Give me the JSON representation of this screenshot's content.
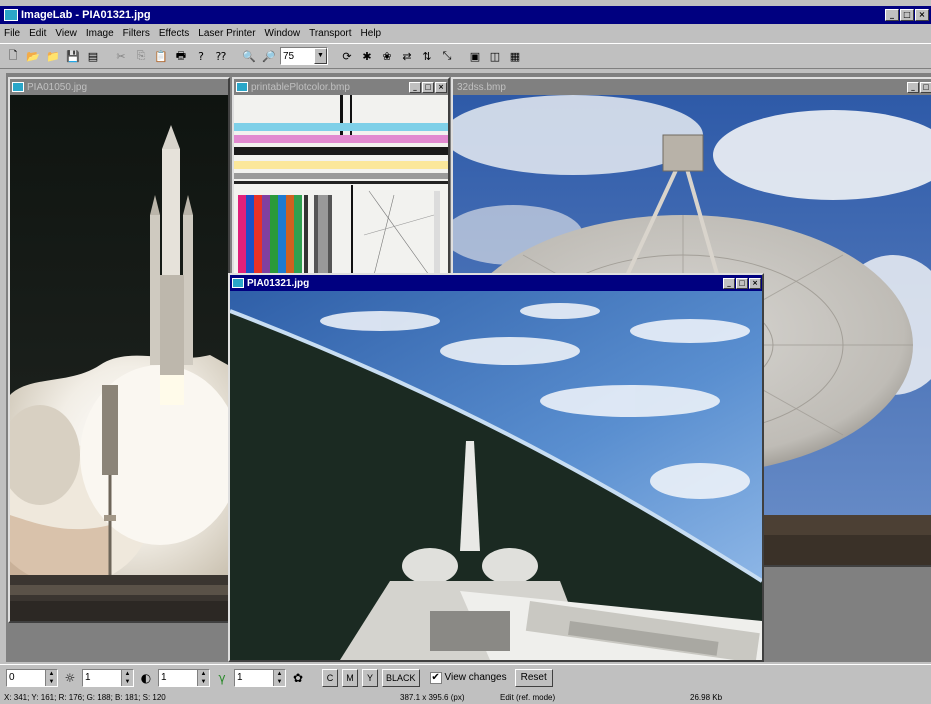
{
  "window": {
    "title": "ImageLab - PIA01321.jpg"
  },
  "menu": [
    "File",
    "Edit",
    "View",
    "Image",
    "Filters",
    "Effects",
    "Laser Printer",
    "Window",
    "Transport",
    "Help"
  ],
  "toolbar": {
    "zoom_value": "75"
  },
  "documents": [
    {
      "title": "PIA01050.jpg",
      "state": "inactive"
    },
    {
      "title": "printablePlotcolor.bmp",
      "state": "inactive"
    },
    {
      "title": "32dss.bmp",
      "state": "inactive"
    },
    {
      "title": "PIA01321.jpg",
      "state": "active"
    }
  ],
  "adjust": {
    "spin1": "0",
    "spin2": "1",
    "spin3": "1",
    "spin4": "1",
    "channel_buttons": [
      "C",
      "M",
      "Y",
      "BLACK"
    ],
    "view_changes_label": "View changes",
    "view_changes_checked": "✔",
    "reset_label": "Reset"
  },
  "status": {
    "pixel_info": "X: 341; Y: 161; R: 176; G: 188; B: 181; S: 120",
    "image_size": "387.1 x 395.6 (px)",
    "mode": "Edit (ref. mode)",
    "memory": "26.98 Kb"
  },
  "colors": {
    "title_active": "#000080",
    "title_inactive": "#808080",
    "face": "#c0c0c0"
  }
}
